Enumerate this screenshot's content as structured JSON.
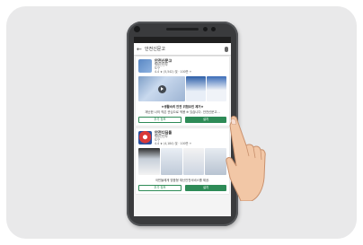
{
  "search": {
    "query": "안전신문고"
  },
  "apps": [
    {
      "name": "안전신문고",
      "developer": "행정안전부",
      "category": "도구",
      "rating": "4.4 ★ (5,542) 및 · 100만 +",
      "desc_title": "★생활속의 안전 위험요인 제거★",
      "desc_line": "재난한 나의 작은 관심으로 적용 ⊕ 있습니다. 안전신문고...",
      "more_label": "추가 정보",
      "install_label": "설치",
      "icon_color": "#5a88c4"
    },
    {
      "name": "안전디딤돌",
      "developer": "행정안전부",
      "category": "도구",
      "rating": "4.4 ★ (4,184) 및 · 100만 +",
      "desc_title": "",
      "desc_line": "국민들에게 맞춤형 재난안전서비스를 제공.",
      "more_label": "추가 정보",
      "install_label": "설치",
      "icon_color": "#d93a3a"
    }
  ]
}
